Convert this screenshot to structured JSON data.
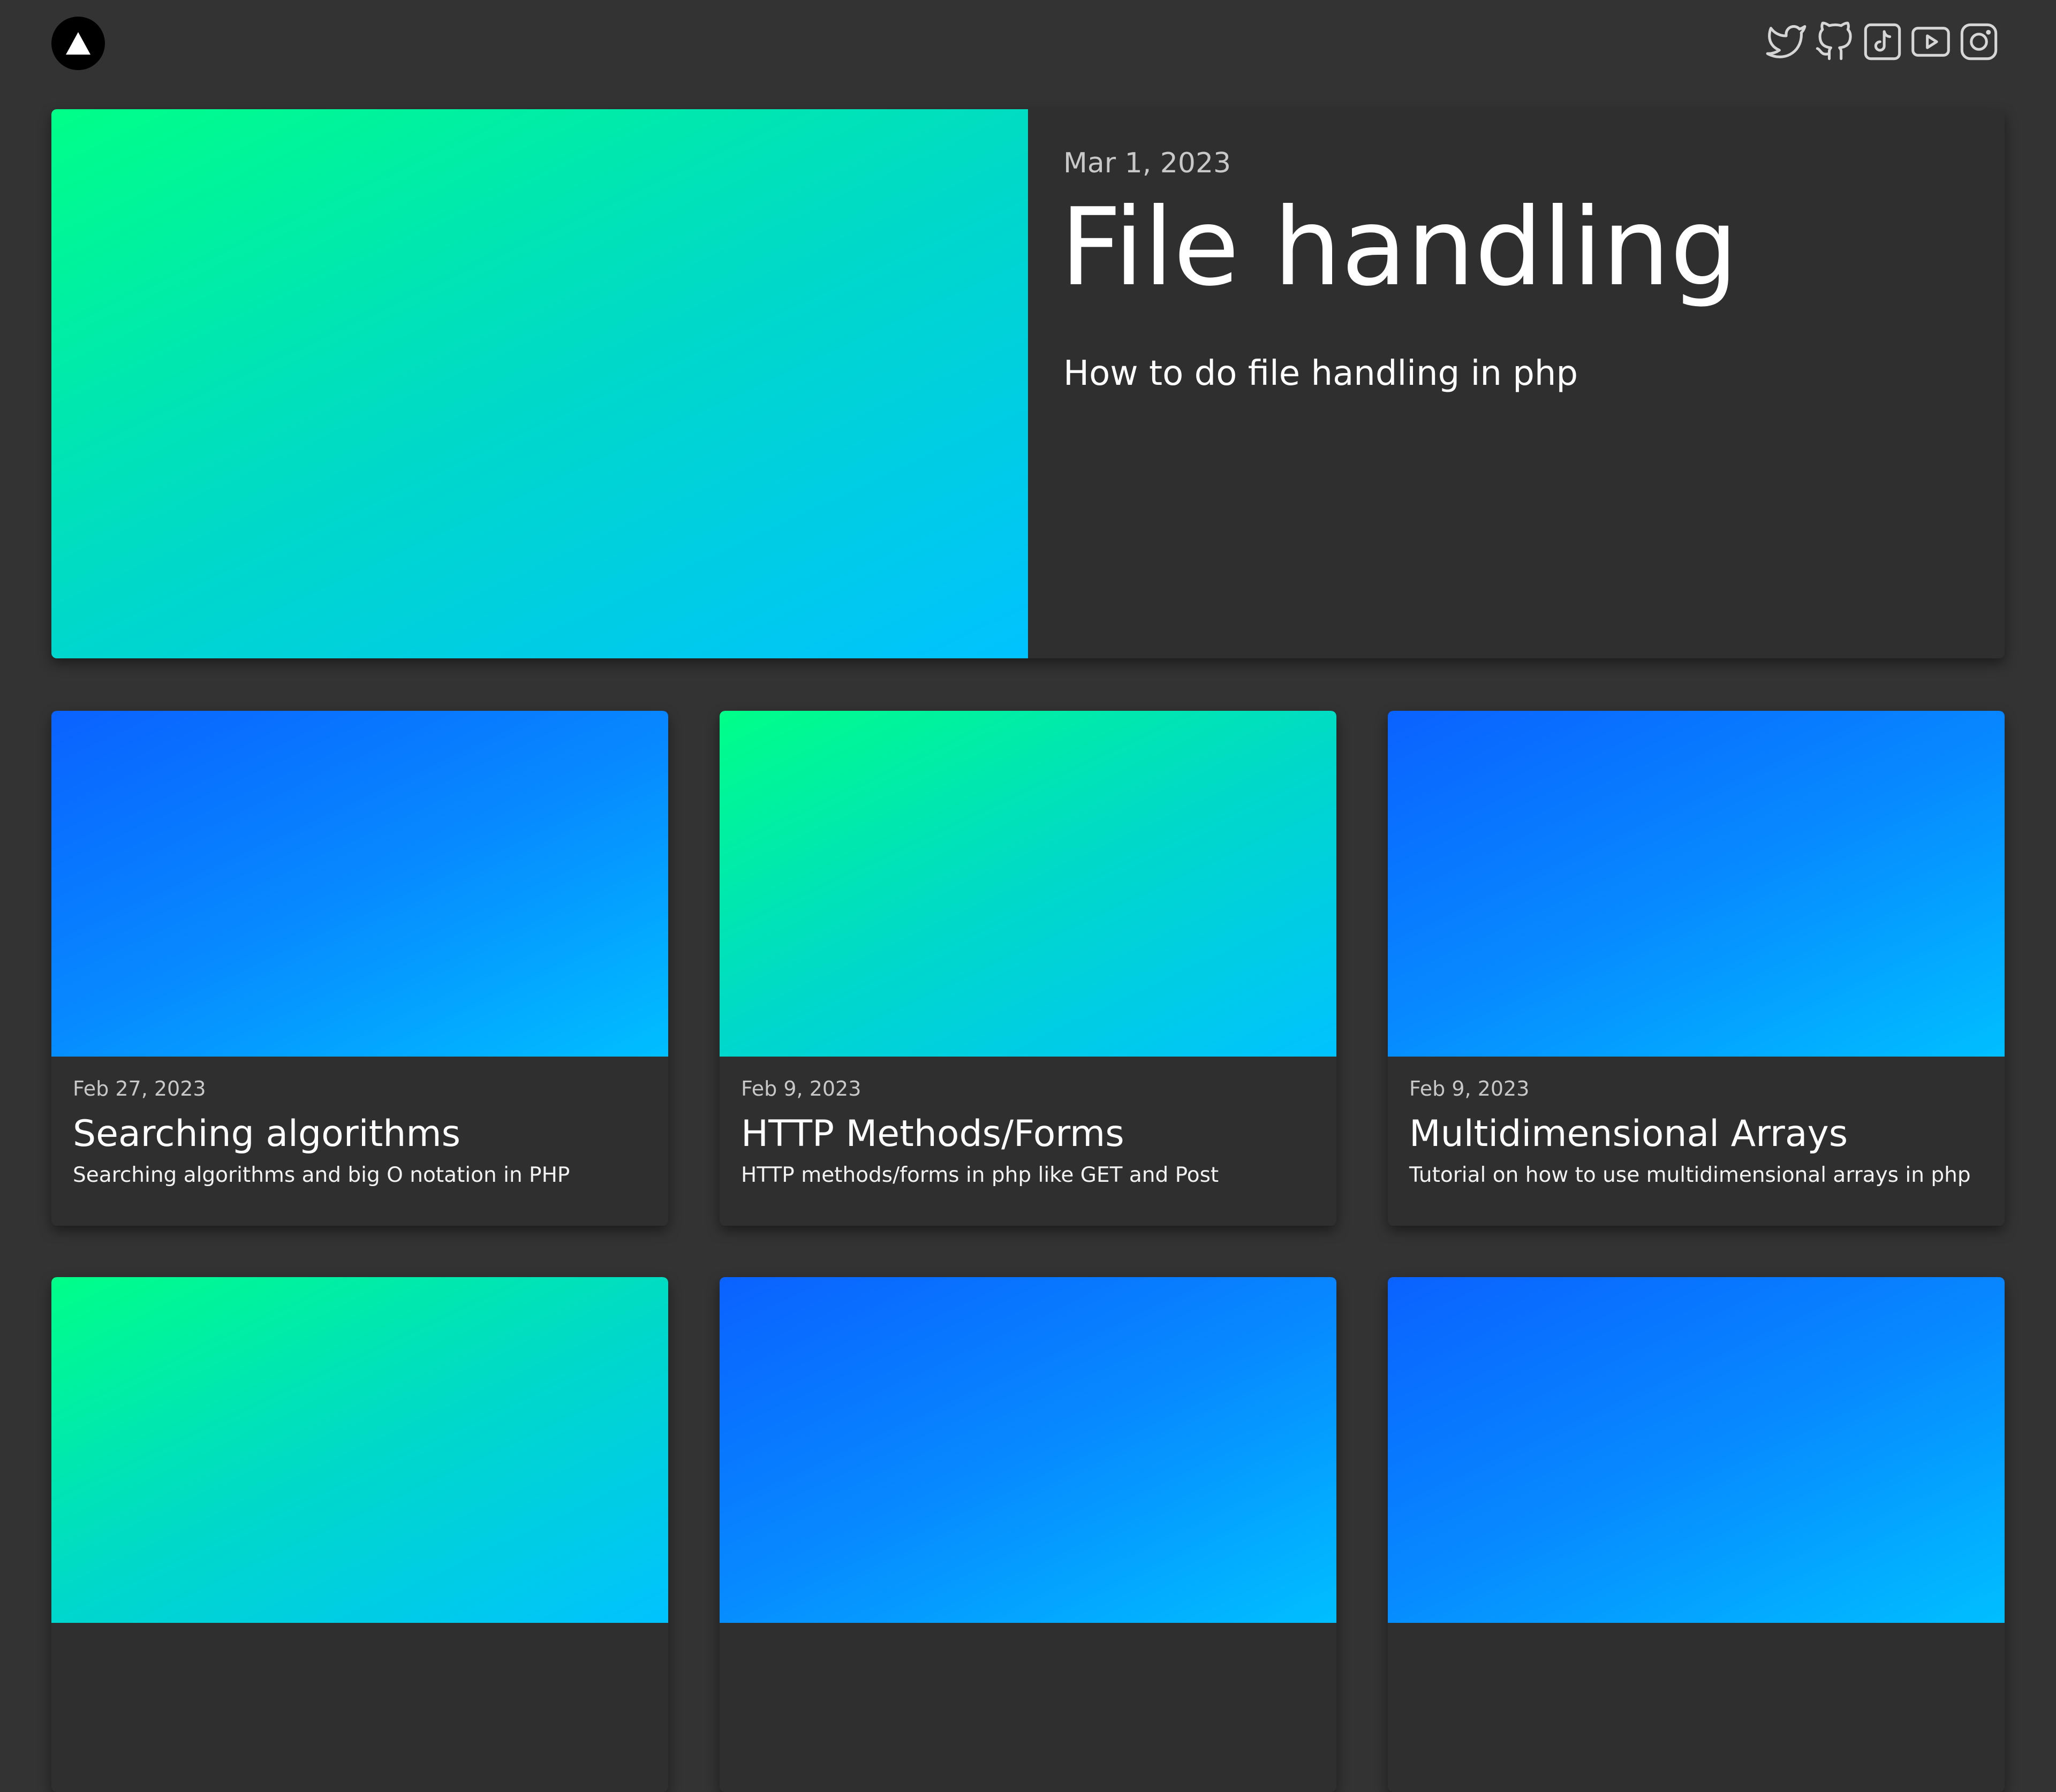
{
  "colors": {
    "background": "#333333",
    "card": "#2f2f2f",
    "date_text": "#c8c8c8",
    "icon": "#d6d6d6",
    "gradient_green": [
      "#00ff88",
      "#00d9c8",
      "#00c2ff"
    ],
    "gradient_blue": [
      "#0a62ff",
      "#0789ff",
      "#00bfff"
    ]
  },
  "header": {
    "logo_icon": "triangle-logo-icon",
    "social": [
      {
        "name": "twitter",
        "icon": "twitter-icon"
      },
      {
        "name": "github",
        "icon": "github-icon"
      },
      {
        "name": "tiktok",
        "icon": "tiktok-icon"
      },
      {
        "name": "youtube",
        "icon": "youtube-icon"
      },
      {
        "name": "instagram",
        "icon": "instagram-icon"
      }
    ]
  },
  "featured": {
    "date": "Mar 1, 2023",
    "title": "File handling",
    "description": "How to do file handling in php",
    "gradient": "green"
  },
  "posts": [
    {
      "date": "Feb 27, 2023",
      "title": "Searching algorithms",
      "description": "Searching algorithms and big O notation in PHP",
      "gradient": "blue"
    },
    {
      "date": "Feb 9, 2023",
      "title": "HTTP Methods/Forms",
      "description": "HTTP methods/forms in php like GET and Post",
      "gradient": "green"
    },
    {
      "date": "Feb 9, 2023",
      "title": "Multidimensional Arrays",
      "description": "Tutorial on how to use multidimensional arrays in php",
      "gradient": "blue"
    },
    {
      "date": "",
      "title": "",
      "description": "",
      "gradient": "green"
    },
    {
      "date": "",
      "title": "",
      "description": "",
      "gradient": "blue"
    },
    {
      "date": "",
      "title": "",
      "description": "",
      "gradient": "blue"
    }
  ]
}
